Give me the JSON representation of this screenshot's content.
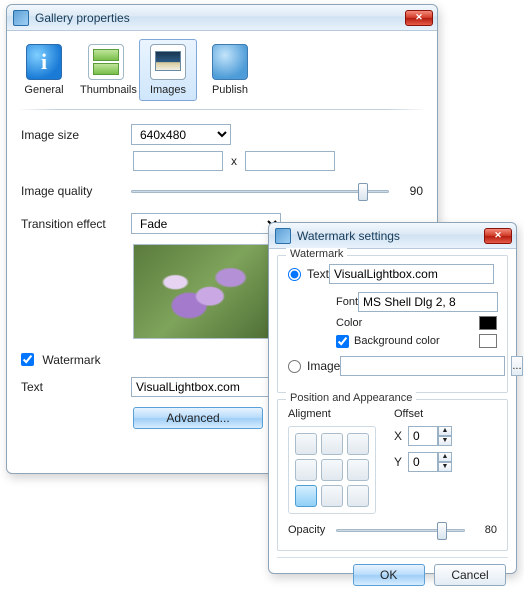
{
  "main": {
    "title": "Gallery properties",
    "tabs": {
      "general": "General",
      "thumbnails": "Thumbnails",
      "images": "Images",
      "publish": "Publish"
    },
    "labels": {
      "image_size": "Image size",
      "image_quality": "Image quality",
      "transition": "Transition effect",
      "watermark": "Watermark",
      "text": "Text"
    },
    "image_size_value": "640x480",
    "width_value": "",
    "height_value": "",
    "dim_x": "x",
    "quality_value": "90",
    "transition_value": "Fade",
    "watermark_checked": true,
    "text_value": "VisualLightbox.com",
    "advanced_btn": "Advanced..."
  },
  "wm": {
    "title": "Watermark settings",
    "group_watermark": "Watermark",
    "radio_text": "Text",
    "radio_image": "Image",
    "text_value": "VisualLightbox.com",
    "font_label": "Font",
    "font_value": "MS Shell Dlg 2, 8",
    "color_label": "Color",
    "bgcolor_label": "Background color",
    "bgcolor_checked": true,
    "image_value": "",
    "browse": "...",
    "group_pos": "Position and Appearance",
    "alignment_label": "Aligment",
    "offset_label": "Offset",
    "x_label": "X",
    "y_label": "Y",
    "offset_x": "0",
    "offset_y": "0",
    "opacity_label": "Opacity",
    "opacity_value": "80",
    "ok": "OK",
    "cancel": "Cancel"
  }
}
